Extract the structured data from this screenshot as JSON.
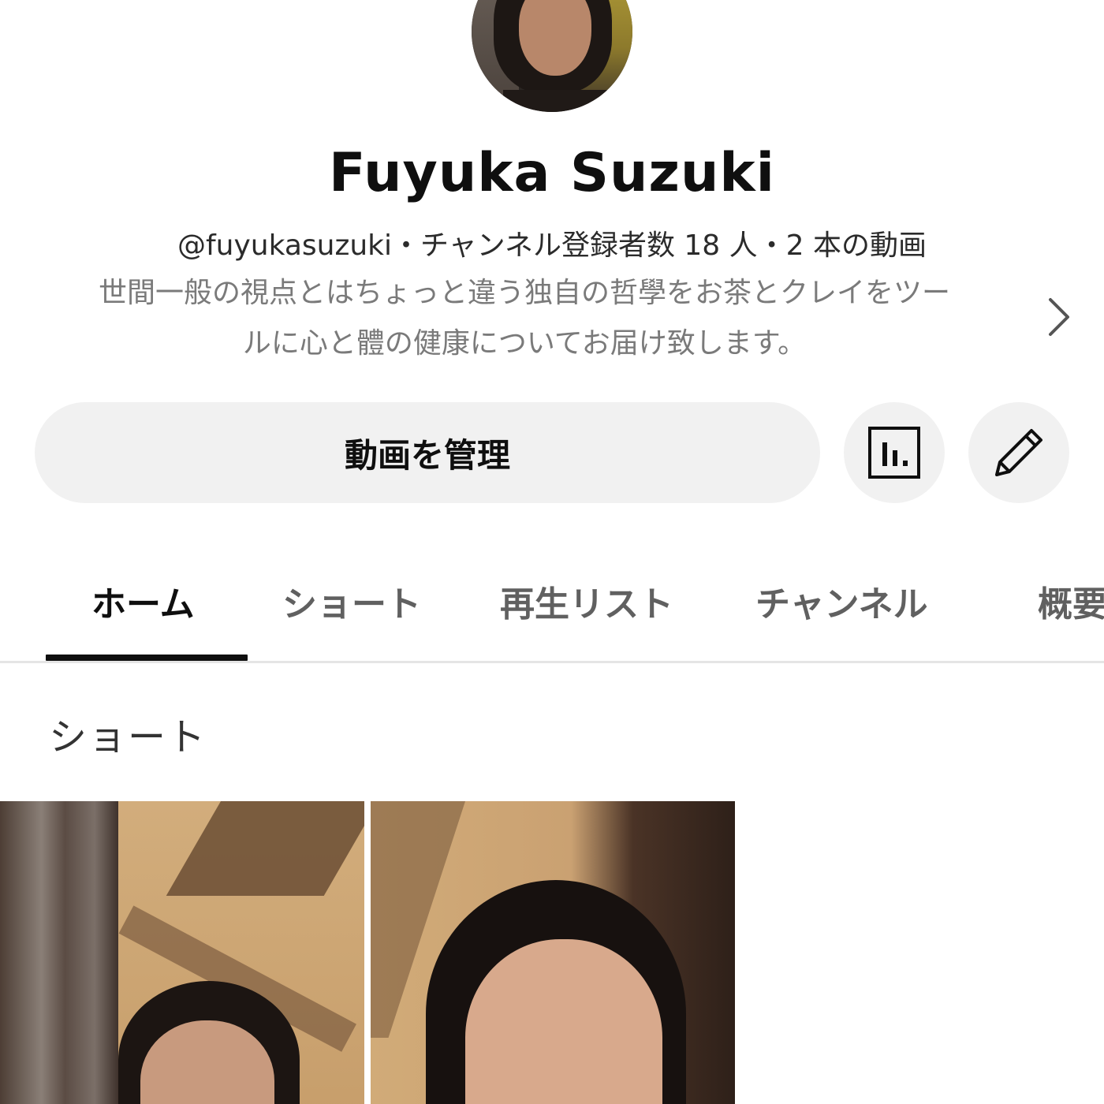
{
  "channel": {
    "name": "Fuyuka Suzuki",
    "meta": "@fuyukasuzuki・チャンネル登録者数 18 人・2 本の動画",
    "description_line1": "世間一般の視点とはちょっと違う独自の哲學をお茶とクレイをツー",
    "description_line2": "ルに心と體の健康についてお届け致します。",
    "avatar": "profile-photo"
  },
  "actions": {
    "manage_label": "動画を管理",
    "analytics_icon": "analytics-icon",
    "edit_icon": "pencil-icon"
  },
  "tabs": [
    {
      "label": "ホーム",
      "active": true
    },
    {
      "label": "ショート",
      "active": false
    },
    {
      "label": "再生リスト",
      "active": false
    },
    {
      "label": "チャンネル",
      "active": false
    },
    {
      "label": "概要",
      "active": false
    }
  ],
  "section": {
    "title": "ショート"
  },
  "shorts": [
    {
      "thumbnail": "short-thumbnail"
    },
    {
      "thumbnail": "short-thumbnail"
    }
  ],
  "colors": {
    "background": "#ffffff",
    "button_bg": "#f1f1f1",
    "text_primary": "#0f0f0f",
    "text_secondary": "#606060",
    "divider": "#e5e5e5"
  }
}
